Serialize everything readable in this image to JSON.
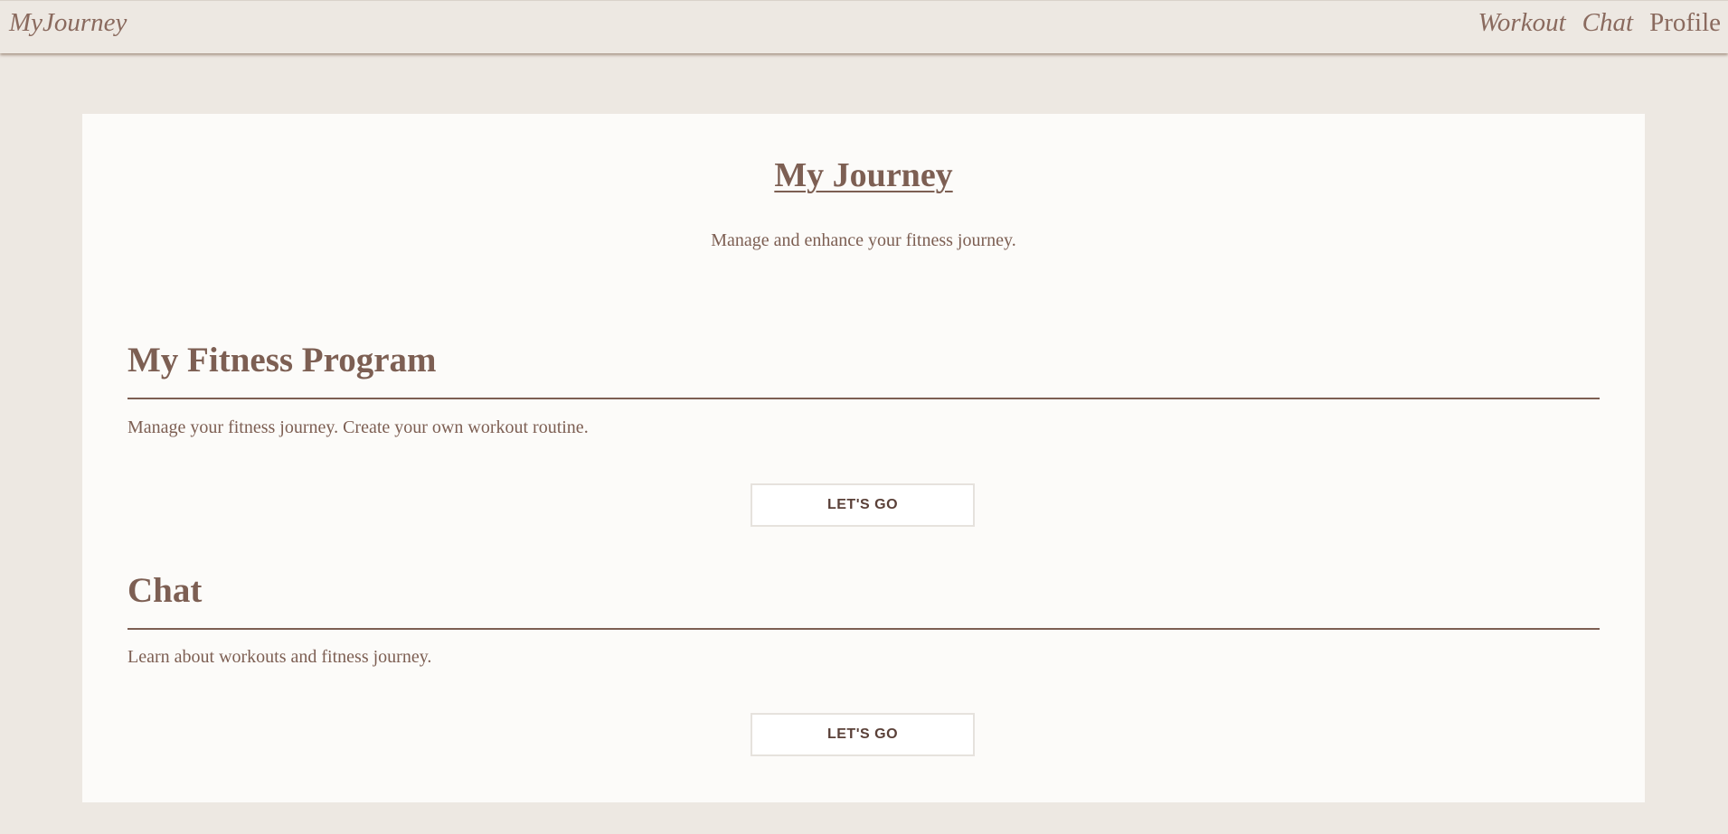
{
  "nav": {
    "brand": "MyJourney",
    "links": [
      {
        "label": "Workout"
      },
      {
        "label": "Chat"
      },
      {
        "label": "Profile"
      }
    ]
  },
  "hero": {
    "title": "My Journey",
    "subtitle": "Manage and enhance your fitness journey."
  },
  "sections": [
    {
      "title": "My Fitness Program",
      "description": "Manage your fitness journey. Create your own workout routine.",
      "button_label": "LET'S GO"
    },
    {
      "title": "Chat",
      "description": "Learn about workouts and fitness journey.",
      "button_label": "LET'S GO"
    }
  ],
  "colors": {
    "page_background": "#ede8e2",
    "card_background": "#fcfbf9",
    "text_brown": "#7d5f53",
    "button_text": "#5a4038"
  }
}
